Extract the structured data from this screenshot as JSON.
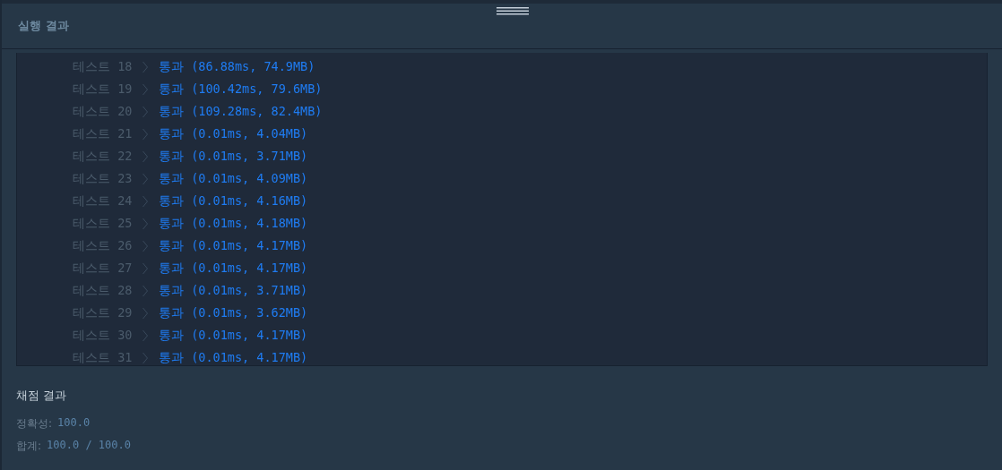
{
  "panel": {
    "title": "실행 결과"
  },
  "tests": [
    {
      "label": "테스트 18",
      "kind": "pass",
      "result": "통과 (86.88ms, 74.9MB)"
    },
    {
      "label": "테스트 19",
      "kind": "pass",
      "result": "통과 (100.42ms, 79.6MB)"
    },
    {
      "label": "테스트 20",
      "kind": "pass",
      "result": "통과 (109.28ms, 82.4MB)"
    },
    {
      "label": "테스트 21",
      "kind": "pass",
      "result": "통과 (0.01ms, 4.04MB)"
    },
    {
      "label": "테스트 22",
      "kind": "pass",
      "result": "통과 (0.01ms, 3.71MB)"
    },
    {
      "label": "테스트 23",
      "kind": "pass",
      "result": "통과 (0.01ms, 4.09MB)"
    },
    {
      "label": "테스트 24",
      "kind": "pass",
      "result": "통과 (0.01ms, 4.16MB)"
    },
    {
      "label": "테스트 25",
      "kind": "pass",
      "result": "통과 (0.01ms, 4.18MB)"
    },
    {
      "label": "테스트 26",
      "kind": "pass",
      "result": "통과 (0.01ms, 4.17MB)"
    },
    {
      "label": "테스트 27",
      "kind": "pass",
      "result": "통과 (0.01ms, 4.17MB)"
    },
    {
      "label": "테스트 28",
      "kind": "pass",
      "result": "통과 (0.01ms, 3.71MB)"
    },
    {
      "label": "테스트 29",
      "kind": "pass",
      "result": "통과 (0.01ms, 3.62MB)"
    },
    {
      "label": "테스트 30",
      "kind": "pass",
      "result": "통과 (0.01ms, 4.17MB)"
    },
    {
      "label": "테스트 31",
      "kind": "pass",
      "result": "통과 (0.01ms, 4.17MB)"
    }
  ],
  "grading": {
    "title": "채점 결과",
    "lines": [
      {
        "label": "정확성:",
        "value": "100.0"
      },
      {
        "label": "합계:",
        "value": "100.0 / 100.0"
      }
    ]
  }
}
